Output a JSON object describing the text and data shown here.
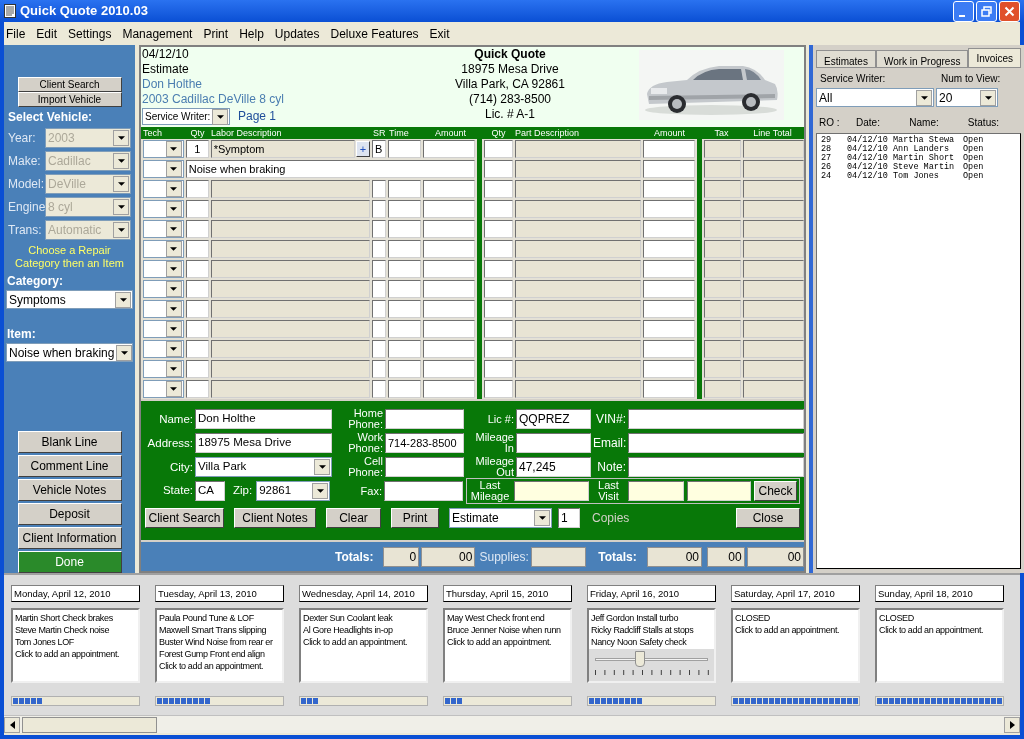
{
  "window": {
    "title": "Quick Quote 2010.03"
  },
  "menu": [
    "File",
    "Edit",
    "Settings",
    "Management",
    "Print",
    "Help",
    "Updates",
    "Deluxe Features",
    "Exit"
  ],
  "sidebar": {
    "top_buttons": [
      "Client Search",
      "Import Vehicle"
    ],
    "vehicle_heading": "Select Vehicle:",
    "vehicle_fields": [
      {
        "label": "Year:",
        "value": "2003",
        "disabled": true
      },
      {
        "label": "Make:",
        "value": "Cadillac",
        "disabled": true
      },
      {
        "label": "Model:",
        "value": "DeVille",
        "disabled": true
      },
      {
        "label": "Engine",
        "value": "8 cyl",
        "disabled": true
      },
      {
        "label": "Trans:",
        "value": "Automatic",
        "disabled": true
      }
    ],
    "hint": "Choose a Repair Category then an Item",
    "category": {
      "label": "Category:",
      "value": "Symptoms"
    },
    "item": {
      "label": "Item:",
      "value": "Noise when braking"
    },
    "buttons": [
      {
        "label": "Blank Line",
        "kind": "normal"
      },
      {
        "label": "Comment Line",
        "kind": "normal"
      },
      {
        "label": "Vehicle Notes",
        "kind": "normal"
      },
      {
        "label": "Deposit",
        "kind": "normal"
      },
      {
        "label": "Client Information",
        "kind": "normal"
      },
      {
        "label": "Done",
        "kind": "primary"
      }
    ]
  },
  "quote_header": {
    "date": "04/12/10",
    "doc_type": "Estimate",
    "client": "Don Holthe",
    "vehicle": "2003 Cadillac DeVille 8 cyl",
    "service_writer": "Service Writer:",
    "page": "Page 1",
    "shop": {
      "name": "Quick Quote",
      "address": "18975 Mesa Drive",
      "city": "Villa Park, CA 92861",
      "phone": "(714) 283-8500",
      "license": "Lic. # A-1"
    }
  },
  "line_items": {
    "columns": [
      "Tech",
      "Qty",
      "Labor Description",
      "SR",
      "Time",
      "Amount",
      "Qty",
      "Part Description",
      "Amount",
      "Tax",
      "Line Total"
    ],
    "lines": [
      {
        "kind": "labor",
        "qty": "1",
        "description": "*Symptom",
        "add": "+",
        "sr": "B"
      },
      {
        "kind": "comment",
        "description": "Noise when braking"
      }
    ]
  },
  "client": {
    "name": {
      "label": "Name:",
      "value": "Don Holthe"
    },
    "address": {
      "label": "Address:",
      "value": "18975 Mesa Drive"
    },
    "city": {
      "label": "City:",
      "value": "Villa Park"
    },
    "state": {
      "label": "State:",
      "value": "CA"
    },
    "zip": {
      "label": "Zip:",
      "value": "92861"
    },
    "home_phone": {
      "label": "Home Phone:"
    },
    "work_phone": {
      "label": "Work Phone:",
      "value": "714-283-8500"
    },
    "cell_phone": {
      "label": "Cell Phone:"
    },
    "fax": {
      "label": "Fax:"
    },
    "license": {
      "label": "Lic #:",
      "value": "QQPREZ"
    },
    "mileage_in": {
      "label": "Mileage In"
    },
    "mileage_out": {
      "label": "Mileage Out",
      "value": "47,245"
    },
    "vin": {
      "label": "VIN#:"
    },
    "email": {
      "label": "Email:"
    },
    "note": {
      "label": "Note:"
    },
    "last_mileage": {
      "label": "Last Mileage"
    },
    "last_visit": {
      "label": "Last Visit"
    },
    "check_button": "Check"
  },
  "actions": {
    "buttons": [
      "Client Search",
      "Client Notes",
      "Clear",
      "Print"
    ],
    "print_type": "Estimate",
    "copies": "1",
    "copies_label": "Copies",
    "close": "Close"
  },
  "totals": {
    "label": "Totals:",
    "labor_count": "0",
    "labor_total": "00",
    "supplies_label": "Supplies:",
    "parts_label": "Totals:",
    "parts_total": "00",
    "tax_total": "00",
    "grand_total": "00"
  },
  "ro_panel": {
    "tabs": [
      {
        "label": "Estimates",
        "selected": false
      },
      {
        "label": "Work in Progress",
        "selected": false
      },
      {
        "label": "Invoices",
        "selected": true
      }
    ],
    "service_writer": {
      "label": "Service Writer:",
      "value": "All"
    },
    "num_to_view": {
      "label": "Num to View:",
      "value": "20"
    },
    "columns": [
      "RO :",
      "Date:",
      "Name:",
      "Status:"
    ],
    "rows": [
      {
        "ro": "29",
        "date": "04/12/10",
        "name": "Martha Stewa",
        "status": "Open"
      },
      {
        "ro": "28",
        "date": "04/12/10",
        "name": "Ann Landers",
        "status": "Open"
      },
      {
        "ro": "27",
        "date": "04/12/10",
        "name": "Martin Short",
        "status": "Open"
      },
      {
        "ro": "26",
        "date": "04/12/10",
        "name": "Steve Martin",
        "status": "Open"
      },
      {
        "ro": "24",
        "date": "04/12/10",
        "name": "Tom Jones",
        "status": "Open"
      }
    ]
  },
  "calendar": [
    {
      "date": "Monday, April 12, 2010",
      "entries": [
        "Martin Short Check brakes",
        "Steve Martin Check noise",
        "Tom Jones LOF",
        "Click to add an appointment."
      ],
      "load": {
        "level": 0.24
      }
    },
    {
      "date": "Tuesday, April 13, 2010",
      "entries": [
        "Paula Pound Tune & LOF",
        "Maxwell Smart Trans slipping",
        "Buster Wind Noise from rear er",
        "Forest Gump Front end align",
        "Click to add an appointment."
      ],
      "load": {
        "level": 0.43
      }
    },
    {
      "date": "Wednesday, April 14, 2010",
      "entries": [
        "Dexter Sun Coolant leak",
        "Al Gore Headlights in-op",
        "Click to add an appointment."
      ],
      "load": {
        "level": 0.14
      }
    },
    {
      "date": "Thursday, April 15, 2010",
      "entries": [
        "May West Check front end",
        "Bruce Jenner Noise when runn",
        "Click to add an appointment."
      ],
      "load": {
        "level": 0.14
      }
    },
    {
      "date": "Friday, April 16, 2010",
      "entries": [
        "Jeff Gordon Install turbo",
        "Ricky Radcliff Stalls at stops",
        "Nancy Noon Safety check"
      ],
      "load": {
        "level": 0.43
      },
      "slider": {
        "level": 0.4
      }
    },
    {
      "date": "Saturday, April 17, 2010",
      "entries": [
        "CLOSED",
        "Click to add an appointment."
      ],
      "load": {
        "level": 1
      }
    },
    {
      "date": "Sunday, April 18, 2010",
      "entries": [
        "CLOSED",
        "Click to add an appointment."
      ],
      "load": {
        "level": 1
      }
    }
  ]
}
